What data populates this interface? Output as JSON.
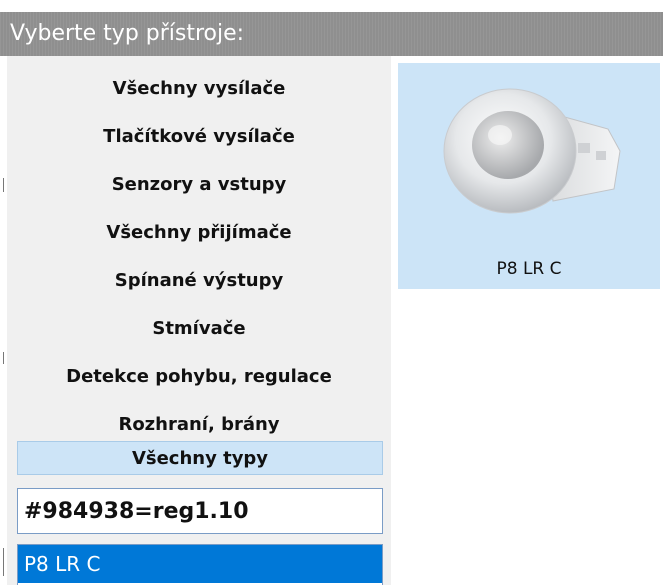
{
  "header": {
    "title": "Vyberte typ přístroje:"
  },
  "categories": [
    {
      "label": "Všechny vysílače"
    },
    {
      "label": "Tlačítkové vysílače"
    },
    {
      "label": "Senzory a vstupy"
    },
    {
      "label": "Všechny přijímače"
    },
    {
      "label": "Spínané výstupy"
    },
    {
      "label": "Stmívače"
    },
    {
      "label": "Detekce pohybu, regulace"
    },
    {
      "label": "Rozhraní, brány"
    },
    {
      "label": "Všechny typy",
      "selected": true
    }
  ],
  "search": {
    "value": "#984938=reg1.10"
  },
  "results": [
    {
      "label": "P8 LR C",
      "selected": true
    }
  ],
  "devices": [
    {
      "label": "P8 LR C"
    }
  ],
  "colors": {
    "title_bar": "#8f8f8f",
    "panel_bg": "#f0f0f0",
    "selected_category": "#cde4f7",
    "result_selected": "#0078d7",
    "device_card": "#cce4f7"
  }
}
